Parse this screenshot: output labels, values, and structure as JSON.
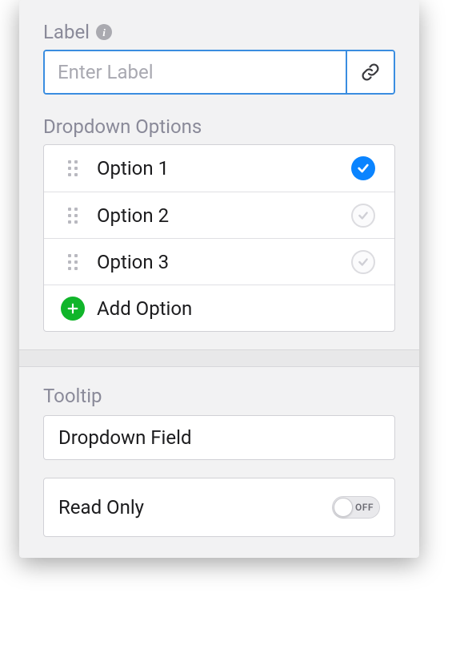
{
  "label": {
    "title": "Label",
    "placeholder": "Enter Label",
    "value": ""
  },
  "dropdownOptions": {
    "title": "Dropdown Options",
    "items": [
      {
        "label": "Option 1",
        "selected": true
      },
      {
        "label": "Option 2",
        "selected": false
      },
      {
        "label": "Option 3",
        "selected": false
      }
    ],
    "addLabel": "Add Option"
  },
  "tooltip": {
    "title": "Tooltip",
    "value": "Dropdown Field"
  },
  "readOnly": {
    "label": "Read Only",
    "state": "OFF"
  }
}
